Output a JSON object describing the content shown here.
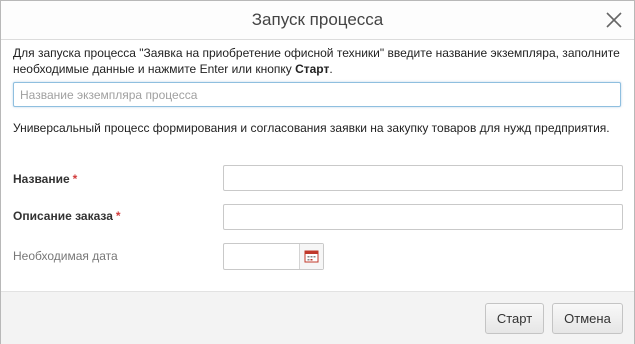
{
  "dialog": {
    "title": "Запуск процесса",
    "close_icon": "close-icon"
  },
  "intro": {
    "text_before": "Для запуска процесса \"Заявка на приобретение офисной техники\" введите название экземпляра, заполните необходимые данные и нажмите Enter или кнопку ",
    "start_word": "Старт",
    "text_after": "."
  },
  "instance_input": {
    "value": "",
    "placeholder": "Название экземпляра процесса"
  },
  "description": "Универсальный процесс формирования и согласования заявки на закупку товаров для нужд предприятия.",
  "fields": {
    "name_label": "Название",
    "order_desc_label": "Описание заказа",
    "required_mark": "*",
    "date_label": "Необходимая дата",
    "calendar_icon": "calendar-icon"
  },
  "footer": {
    "start_label": "Старт",
    "cancel_label": "Отмена"
  },
  "colors": {
    "required_star": "#d23c3c",
    "focused_border": "#8fbfdf",
    "calendar_accent": "#c0392b"
  }
}
